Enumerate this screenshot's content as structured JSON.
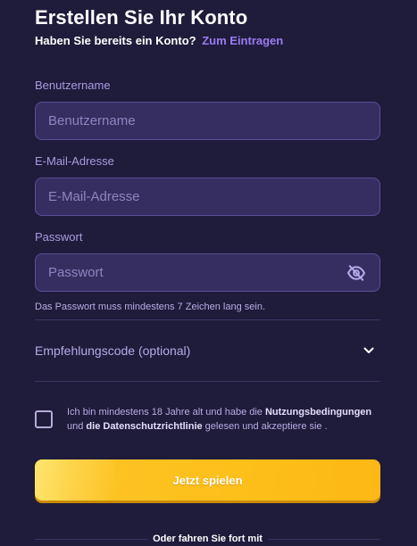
{
  "header": {
    "title": "Erstellen Sie Ihr Konto",
    "signin_prompt": "Haben Sie bereits ein Konto?",
    "signin_link": "Zum Eintragen"
  },
  "form": {
    "username": {
      "label": "Benutzername",
      "placeholder": "Benutzername",
      "value": ""
    },
    "email": {
      "label": "E-Mail-Adresse",
      "placeholder": "E-Mail-Adresse",
      "value": ""
    },
    "password": {
      "label": "Passwort",
      "placeholder": "Passwort",
      "value": "",
      "visibility_icon": "eye-off-icon",
      "hint": "Das Passwort muss mindestens 7 Zeichen lang sein."
    },
    "referral": {
      "label": "Empfehlungscode (optional)",
      "icon": "chevron-down-icon"
    },
    "terms": {
      "checked": false,
      "text_1": "Ich bin mindestens 18 Jahre alt und habe die ",
      "terms_link": "Nutzungsbedingungen",
      "text_2": " und ",
      "privacy_link": "die Datenschutzrichtlinie",
      "text_3": " gelesen und akzeptiere sie ."
    },
    "submit_label": "Jetzt spielen",
    "alternative_label": "Oder fahren Sie fort mit"
  },
  "colors": {
    "background": "#1f1b3a",
    "input_background": "#362e60",
    "input_border": "#5a4e98",
    "link": "#9b7cf2",
    "label": "#a99be0",
    "button": "#fdbf1a"
  }
}
